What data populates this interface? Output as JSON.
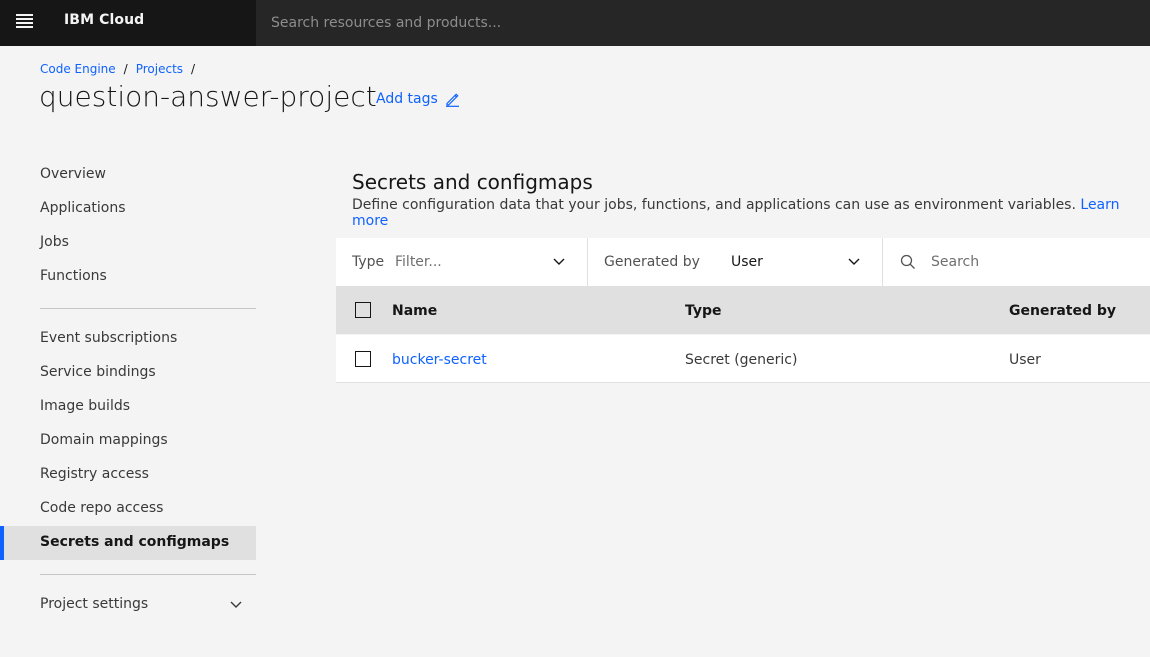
{
  "header": {
    "brand": "IBM Cloud",
    "search_placeholder": "Search resources and products..."
  },
  "breadcrumb": [
    "Code Engine",
    "Projects"
  ],
  "page": {
    "title": "question-answer-project",
    "add_tags": "Add tags"
  },
  "sidebar": {
    "group1": [
      "Overview",
      "Applications",
      "Jobs",
      "Functions"
    ],
    "group2": [
      "Event subscriptions",
      "Service bindings",
      "Image builds",
      "Domain mappings",
      "Registry access",
      "Code repo access",
      "Secrets and configmaps"
    ],
    "active": "Secrets and configmaps",
    "settings": "Project settings"
  },
  "section": {
    "title": "Secrets and configmaps",
    "description": "Define configuration data that your jobs, functions, and applications can use as environment variables.",
    "learn_more": "Learn more"
  },
  "filters": {
    "type_label": "Type",
    "type_placeholder": "Filter...",
    "generated_label": "Generated by",
    "generated_value": "User",
    "search_placeholder": "Search"
  },
  "table": {
    "columns": [
      "Name",
      "Type",
      "Generated by"
    ],
    "rows": [
      {
        "name": "bucker-secret",
        "type": "Secret (generic)",
        "generated_by": "User"
      }
    ]
  },
  "icons": [
    "menu-icon",
    "edit-icon",
    "chevron-down-icon",
    "search-icon"
  ],
  "colors": {
    "accent": "#0f62fe",
    "topbar": "#161616"
  }
}
